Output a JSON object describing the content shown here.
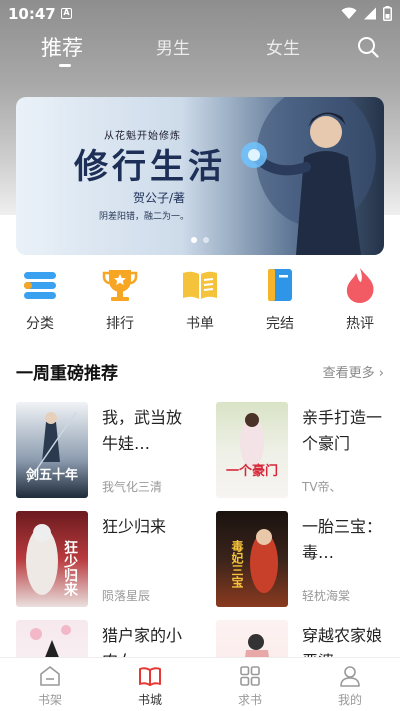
{
  "status": {
    "time": "10:47",
    "notif": "A"
  },
  "tabs": [
    {
      "label": "推荐"
    },
    {
      "label": "男生"
    },
    {
      "label": "女生"
    }
  ],
  "banner": {
    "subtitle": "从花魁开始修炼",
    "title": "修行生活",
    "author": "贺公子/著",
    "tagline": "阴差阳错，融二为一。",
    "slides": 2,
    "active_slide": 1
  },
  "categories": [
    {
      "label": "分类",
      "icon": "category-icon",
      "color": "#3aa0f0"
    },
    {
      "label": "排行",
      "icon": "trophy-icon",
      "color": "#f6a623"
    },
    {
      "label": "书单",
      "icon": "book-list-icon",
      "color": "#f5c33b"
    },
    {
      "label": "完结",
      "icon": "finished-book-icon",
      "color": "#2f95e6"
    },
    {
      "label": "热评",
      "icon": "fire-icon",
      "color": "#f25a64"
    }
  ],
  "section": {
    "title": "一周重磅推荐",
    "more": "查看更多"
  },
  "books": [
    {
      "title": "我，武当放牛娃…",
      "author": "我气化三清",
      "cover_text": "剑五十年"
    },
    {
      "title": "亲手打造一个豪门",
      "author": "TV帝、",
      "cover_text": "一个豪门"
    },
    {
      "title": "狂少归来",
      "author": "陨落星辰",
      "cover_text": "狂少归来"
    },
    {
      "title": "一胎三宝：毒…",
      "author": "轻枕海棠",
      "cover_text": "毒妃三宝"
    },
    {
      "title": "猎户家的小农女",
      "author": "",
      "cover_text": ""
    },
    {
      "title": "穿越农家娘恶婆",
      "author": "",
      "cover_text": ""
    }
  ],
  "bottom_nav": [
    {
      "label": "书架",
      "icon": "bookshelf-icon"
    },
    {
      "label": "书城",
      "icon": "bookstore-icon",
      "active": true
    },
    {
      "label": "求书",
      "icon": "request-book-icon"
    },
    {
      "label": "我的",
      "icon": "profile-icon"
    }
  ],
  "colors": {
    "accent": "#e53935",
    "text": "#222222",
    "muted": "#999999"
  }
}
